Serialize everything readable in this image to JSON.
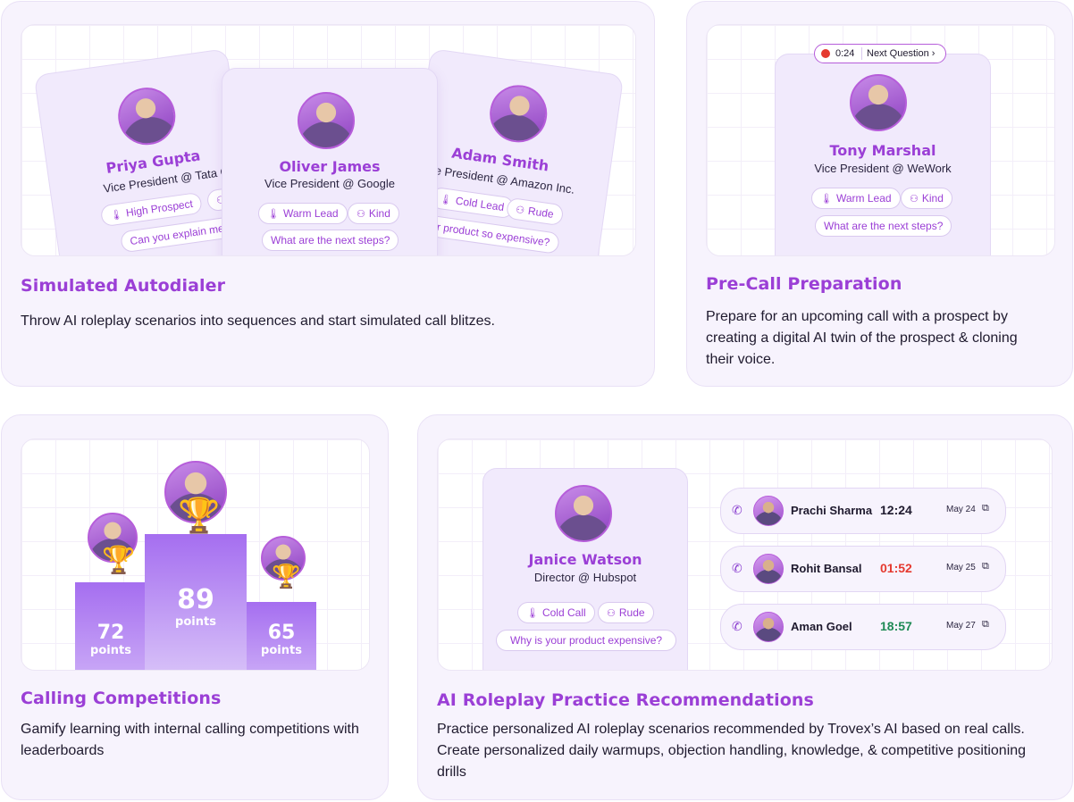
{
  "autodialer": {
    "title": "Simulated Autodialer",
    "description": "Throw AI roleplay scenarios into sequences and start simulated call blitzes.",
    "cards": [
      {
        "name": "Priya Gupta",
        "role": "Vice President @ Tata Co",
        "tags": [
          "High Prospect",
          "W"
        ],
        "question": "Can you explain me ab"
      },
      {
        "name": "Oliver James",
        "role": "Vice President @ Google",
        "tags": [
          "Warm Lead",
          "Kind"
        ],
        "question": "What are the next steps?"
      },
      {
        "name": "Adam Smith",
        "role": "ce President @ Amazon Inc.",
        "tags": [
          "Cold Lead",
          "Rude"
        ],
        "question": "our product so expensive?"
      }
    ]
  },
  "precall": {
    "title": "Pre-Call Preparation",
    "description": "Prepare for an upcoming call with a prospect by creating a digital AI twin of the prospect & cloning their voice.",
    "timer": "0:24",
    "next_label": "Next Question",
    "card": {
      "name": "Tony Marshal",
      "role": "Vice President @ WeWork",
      "tags": [
        "Warm Lead",
        "Kind"
      ],
      "question": "What are the next steps?"
    }
  },
  "competitions": {
    "title": "Calling Competitions",
    "description": "Gamify learning with internal calling competitions with leaderboards",
    "podium": [
      {
        "rank": "2",
        "points": "72",
        "label": "points"
      },
      {
        "rank": "1",
        "points": "89",
        "label": "points"
      },
      {
        "rank": "3",
        "points": "65",
        "label": "points"
      }
    ]
  },
  "roleplay": {
    "title": "AI Roleplay Practice Recommendations",
    "description": "Practice personalized AI roleplay scenarios recommended by Trovex’s  AI based on real calls. Create personalized daily warmups, objection handling, knowledge, & competitive positioning drills",
    "card": {
      "name": "Janice Watson",
      "role": "Director @ Hubspot",
      "tags": [
        "Cold Call",
        "Rude"
      ],
      "question": "Why is your product expensive?"
    },
    "calls": [
      {
        "name": "Prachi Sharma",
        "duration": "12:24",
        "date": "May 24",
        "color": "#1f1a2e"
      },
      {
        "name": "Rohit Bansal",
        "duration": "01:52",
        "date": "May 25",
        "color": "#e5392f"
      },
      {
        "name": "Aman Goel",
        "duration": "18:57",
        "date": "May 27",
        "color": "#1f8a55"
      }
    ]
  },
  "icons": {
    "thermometer": "thermometer-icon",
    "brain": "brain-icon",
    "phone": "phone-icon",
    "external": "external-link-icon",
    "record": "record-icon",
    "chevron": "chevron-right-icon",
    "trophy": "trophy-icon"
  }
}
